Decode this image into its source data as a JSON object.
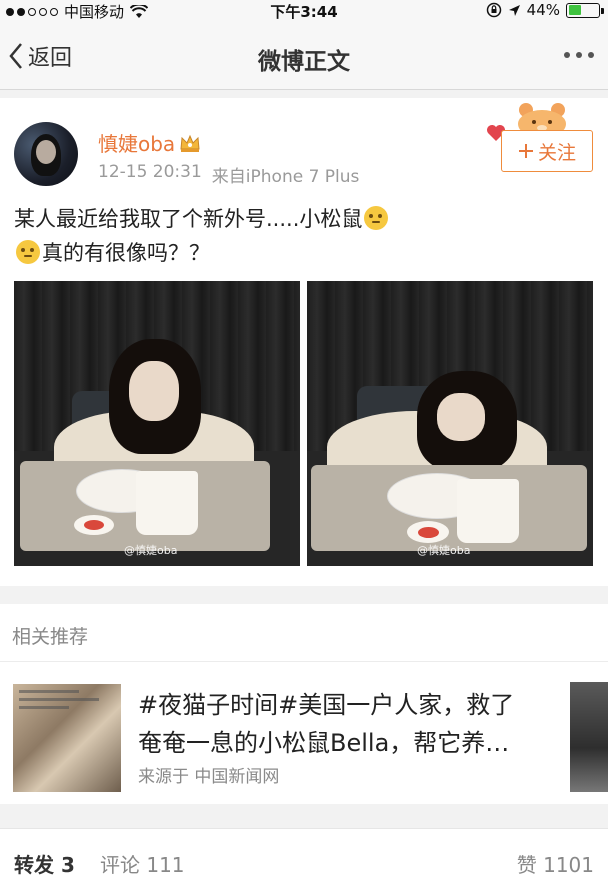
{
  "status_bar": {
    "carrier": "中国移动",
    "time": "下午3:44",
    "battery": "44%",
    "battery_level": 0.44
  },
  "nav": {
    "back_label": "返回",
    "title": "微博正文"
  },
  "post": {
    "username": "慎婕oba",
    "timestamp": "12-15 20:31",
    "source": "来自iPhone 7 Plus",
    "follow_label": "关注",
    "text_line1": "某人最近给我取了个新外号.....小松鼠",
    "text_line2": "真的有很像吗？？",
    "images": [
      {
        "watermark": "@慎婕oba"
      },
      {
        "watermark": "@慎婕oba"
      }
    ]
  },
  "related": {
    "title": "相关推荐",
    "item": {
      "line1": "#夜猫子时间#美国一户人家，救了",
      "line2": "奄奄一息的小松鼠Bella，帮它养…",
      "source": "来源于 中国新闻网"
    }
  },
  "actions": {
    "repost": "转发 3",
    "comment": "评论 111",
    "like": "赞 1101"
  },
  "colors": {
    "accent": "#e8773a",
    "battery": "#3fc33f"
  }
}
